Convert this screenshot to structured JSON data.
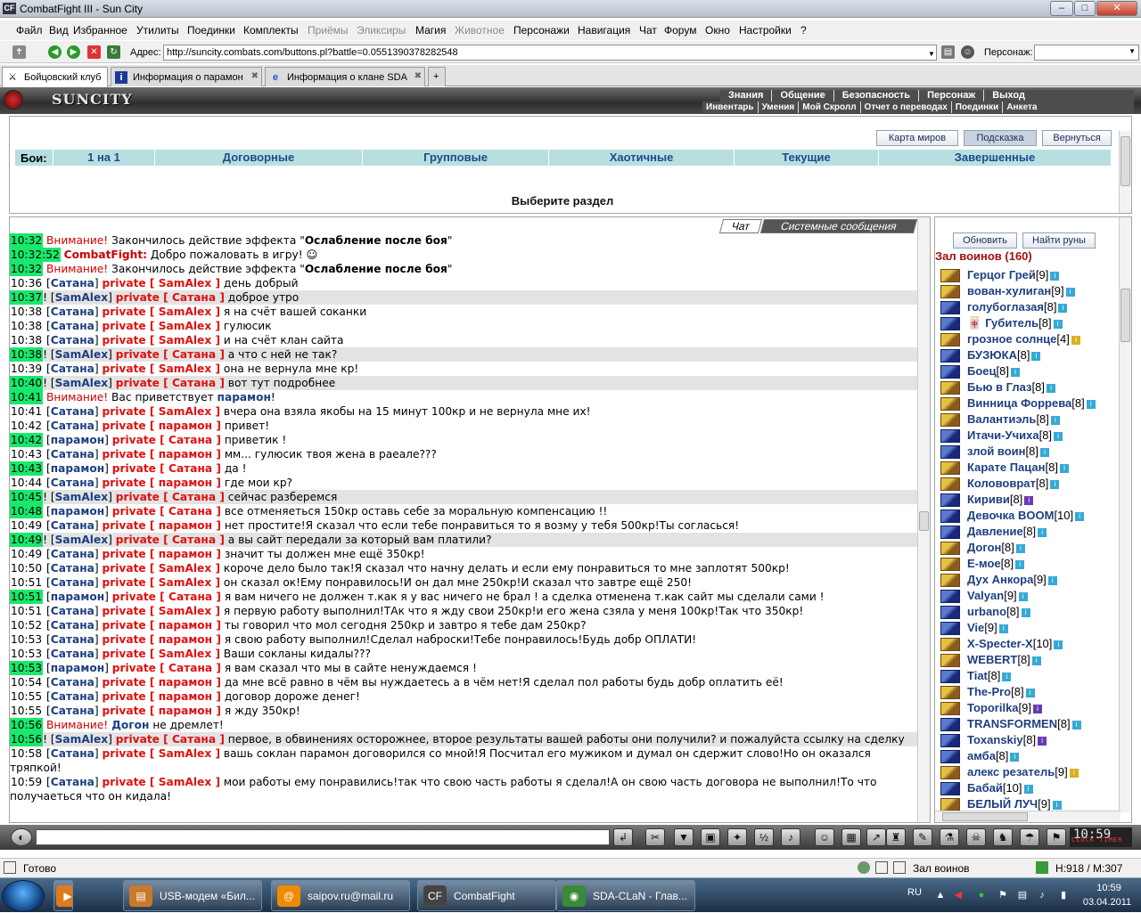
{
  "window": {
    "title": "CombatFight III - Sun City",
    "app_icon": "CF",
    "min": "–",
    "max": "□",
    "close": "✕"
  },
  "menu": [
    {
      "label": "Файл",
      "disabled": false
    },
    {
      "label": "Вид",
      "disabled": false
    },
    {
      "label": "Избранное",
      "disabled": false
    },
    {
      "label": "Утилиты",
      "disabled": false
    },
    {
      "label": "Поединки",
      "disabled": false
    },
    {
      "label": "Комплекты",
      "disabled": false
    },
    {
      "label": "Приёмы",
      "disabled": true
    },
    {
      "label": "Эликсиры",
      "disabled": true
    },
    {
      "label": "Магия",
      "disabled": false
    },
    {
      "label": "Животное",
      "disabled": true
    },
    {
      "label": "Персонажи",
      "disabled": false
    },
    {
      "label": "Навигация",
      "disabled": false
    },
    {
      "label": "Чат",
      "disabled": false
    },
    {
      "label": "Форум",
      "disabled": false
    },
    {
      "label": "Окно",
      "disabled": false
    },
    {
      "label": "Настройки",
      "disabled": false
    },
    {
      "label": "?",
      "disabled": false
    }
  ],
  "address": {
    "label": "Адрес:",
    "value": "http://suncity.combats.com/buttons.pl?battle=0.0551390378282548",
    "persona_label": "Персонаж:"
  },
  "tabs": [
    {
      "label": "Бойцовский клуб",
      "icon": "sword-icon",
      "glyph": "⚔"
    },
    {
      "label": "Информация о парамон",
      "icon": "info-icon",
      "glyph": "i"
    },
    {
      "label": "Информация о клане SDA",
      "icon": "browser-icon",
      "glyph": "e"
    }
  ],
  "header": {
    "logo": "SUNCITY",
    "nav1": [
      "Знания",
      "Общение",
      "Безопасность",
      "Персонаж",
      "Выход"
    ],
    "nav2": [
      "Инвентарь",
      "Умения",
      "Мой Скролл",
      "Отчет о переводах",
      "Поединки",
      "Анкета"
    ]
  },
  "upper": {
    "buttons": [
      "Карта миров",
      "Подсказка",
      "Вернуться"
    ],
    "battles_label": "Бои:",
    "battle_types": [
      "1 на 1",
      "Договорные",
      "Групповые",
      "Хаотичные",
      "Текущие",
      "Завершенные"
    ],
    "prompt": "Выберите раздел"
  },
  "chat": {
    "tab_chat": "Чат",
    "tab_system": "Системные сообщения",
    "messages": [
      {
        "t": "10:32",
        "g": true,
        "type": "sys",
        "pre": "Внимание!",
        "text": " Закончилось действие эффекта \"",
        "bold": "Ослабление после боя",
        "post": "\""
      },
      {
        "t": "10:32:52",
        "g": true,
        "type": "cf",
        "pre": "CombatFight:",
        "text": " Добро пожаловать в игру! ☺"
      },
      {
        "t": "10:32",
        "g": true,
        "type": "sys",
        "pre": "Внимание!",
        "text": " Закончилось действие эффекта \"",
        "bold": "Ослабление после боя",
        "post": "\""
      },
      {
        "t": "10:36",
        "from": "Сатана",
        "to": "SamAlex",
        "text": "день добрый"
      },
      {
        "t": "10:37",
        "g": true,
        "hl": true,
        "from": "SamAlex",
        "to": "Сатана",
        "text": "доброе утро",
        "excl": true
      },
      {
        "t": "10:38",
        "from": "Сатана",
        "to": "SamAlex",
        "text": "я на счёт вашей соканки"
      },
      {
        "t": "10:38",
        "from": "Сатана",
        "to": "SamAlex",
        "text": "гулюсик"
      },
      {
        "t": "10:38",
        "from": "Сатана",
        "to": "SamAlex",
        "text": "и на счёт клан сайта"
      },
      {
        "t": "10:38",
        "g": true,
        "hl": true,
        "from": "SamAlex",
        "to": "Сатана",
        "text": "а что с ней не так?",
        "excl": true
      },
      {
        "t": "10:39",
        "from": "Сатана",
        "to": "SamAlex",
        "text": "она не вернула мне кр!"
      },
      {
        "t": "10:40",
        "g": true,
        "hl": true,
        "from": "SamAlex",
        "to": "Сатана",
        "text": "вот тут подробнее",
        "excl": true
      },
      {
        "t": "10:41",
        "g": true,
        "type": "sys",
        "pre": "Внимание!",
        "text": " Вас приветствует ",
        "nick": "парамон",
        "post": "!"
      },
      {
        "t": "10:41",
        "from": "Сатана",
        "to": "SamAlex",
        "text": "вчера она взяла якобы на 15 минут 100кр и не вернула мне их!"
      },
      {
        "t": "10:42",
        "from": "Сатана",
        "to": "парамон",
        "text": "привет!"
      },
      {
        "t": "10:42",
        "g": true,
        "from": "парамон",
        "to": "Сатана",
        "text": "приветик !"
      },
      {
        "t": "10:43",
        "from": "Сатана",
        "to": "парамон",
        "text": "мм... гулюсик твоя жена в раеале???"
      },
      {
        "t": "10:43",
        "g": true,
        "from": "парамон",
        "to": "Сатана",
        "text": "да !"
      },
      {
        "t": "10:44",
        "from": "Сатана",
        "to": "парамон",
        "text": "где мои кр?"
      },
      {
        "t": "10:45",
        "g": true,
        "hl": true,
        "from": "SamAlex",
        "to": "Сатана",
        "text": "сейчас разберемся",
        "excl": true
      },
      {
        "t": "10:48",
        "g": true,
        "from": "парамон",
        "to": "Сатана",
        "text": "все отменяеться 150кр оставь себе за моральную компенсацию !!"
      },
      {
        "t": "10:49",
        "from": "Сатана",
        "to": "парамон",
        "text": "нет простите!Я сказал что если тебе понравиться то я возму у тебя 500кр!Ты согласься!"
      },
      {
        "t": "10:49",
        "g": true,
        "hl": true,
        "from": "SamAlex",
        "to": "Сатана",
        "text": "а вы сайт передали за который вам платили?",
        "excl": true
      },
      {
        "t": "10:49",
        "from": "Сатана",
        "to": "парамон",
        "text": "значит ты должен мне ещё 350кр!"
      },
      {
        "t": "10:50",
        "from": "Сатана",
        "to": "SamAlex",
        "text": "короче дело было так!Я сказал что начну делать и если ему понравиться то мне заплотят 500кр!"
      },
      {
        "t": "10:51",
        "from": "Сатана",
        "to": "SamAlex",
        "text": "он сказал ок!Ему понравилось!И он дал мне 250кр!И сказал что завтре ещё 250!"
      },
      {
        "t": "10:51",
        "g": true,
        "from": "парамон",
        "to": "Сатана",
        "text": "я вам ничего не должен т.как я у вас ничего не брал ! а сделка отменена т.как сайт мы сделали сами !"
      },
      {
        "t": "10:51",
        "from": "Сатана",
        "to": "SamAlex",
        "text": "я первую работу выполнил!ТАк что я жду свои 250кр!и его жена сзяла у меня 100кр!Так что 350кр!"
      },
      {
        "t": "10:52",
        "from": "Сатана",
        "to": "парамон",
        "text": "ты говорил что мол сегодня 250кр и завтро я тебе дам 250кр?"
      },
      {
        "t": "10:53",
        "from": "Сатана",
        "to": "парамон",
        "text": "я свою работу выполнил!Сделал наброски!Тебе понравилось!Будь добр ОПЛАТИ!"
      },
      {
        "t": "10:53",
        "from": "Сатана",
        "to": "SamAlex",
        "text": "Ваши сокланы кидалы???"
      },
      {
        "t": "10:53",
        "g": true,
        "from": "парамон",
        "to": "Сатана",
        "text": "я вам сказал что мы в сайте ненуждаемся !"
      },
      {
        "t": "10:54",
        "from": "Сатана",
        "to": "парамон",
        "text": "да мне всё равно в чём вы нуждаетесь а в чём нет!Я сделал пол работы будь добр оплатить её!"
      },
      {
        "t": "10:55",
        "from": "Сатана",
        "to": "парамон",
        "text": "договор дороже денег!"
      },
      {
        "t": "10:55",
        "from": "Сатана",
        "to": "парамон",
        "text": "я жду 350кр!"
      },
      {
        "t": "10:56",
        "g": true,
        "type": "sys",
        "pre": "Внимание!",
        "text": " ",
        "nick": "Догон",
        "post": " не дремлет!"
      },
      {
        "t": "10:56",
        "g": true,
        "hl": true,
        "from": "SamAlex",
        "to": "Сатана",
        "text": "первое, в обвинениях осторожнее, второе результаты вашей работы они получили? и пожалуйста ссылку на сделку",
        "excl": true
      },
      {
        "t": "10:58",
        "from": "Сатана",
        "to": "SamAlex",
        "text": "вашь соклан парамон договорился со мной!Я Посчитал его мужиком и думал он сдержит слово!Но он оказался тряпкой!"
      },
      {
        "t": "10:59",
        "from": "Сатана",
        "to": "SamAlex",
        "text": "мои работы ему понравились!так что свою часть работы я сделал!А он свою часть договора не выполнил!То что получаеться что он кидала!"
      }
    ]
  },
  "roster": {
    "refresh": "Обновить",
    "find_runes": "Найти руны",
    "title": "Зал воинов (160)",
    "players": [
      {
        "name": "Герцог Грей",
        "lvl": "[9]",
        "ic": "y",
        "inf": "b"
      },
      {
        "name": "вован-хулиган",
        "lvl": "[9]",
        "ic": "y",
        "inf": "b"
      },
      {
        "name": "голубоглазая",
        "lvl": "[8]",
        "ic": "b",
        "inf": "b"
      },
      {
        "name": "Губитель",
        "lvl": "[8]",
        "ic": "b",
        "inf": "b",
        "badge": "🀄"
      },
      {
        "name": "грозное солнце",
        "lvl": "[4]",
        "ic": "y",
        "inf": "g"
      },
      {
        "name": "БУЗЮКА",
        "lvl": "[8]",
        "ic": "b",
        "inf": "b"
      },
      {
        "name": "Боец",
        "lvl": "[8]",
        "ic": "b",
        "inf": "b"
      },
      {
        "name": "Бью в Глаз",
        "lvl": "[8]",
        "ic": "y",
        "inf": "b"
      },
      {
        "name": "Винница Форрева",
        "lvl": "[8]",
        "ic": "y",
        "inf": "b"
      },
      {
        "name": "Валантиэль",
        "lvl": "[8]",
        "ic": "y",
        "inf": "b"
      },
      {
        "name": "Итачи-Учиха",
        "lvl": "[8]",
        "ic": "b",
        "inf": "b"
      },
      {
        "name": "злой воин",
        "lvl": "[8]",
        "ic": "b",
        "inf": "b"
      },
      {
        "name": "Карате Пацан",
        "lvl": "[8]",
        "ic": "y",
        "inf": "b"
      },
      {
        "name": "Колововрат",
        "lvl": "[8]",
        "ic": "y",
        "inf": "b"
      },
      {
        "name": "Кириви",
        "lvl": "[8]",
        "ic": "b",
        "inf": "p"
      },
      {
        "name": "Девочка BOOM",
        "lvl": "[10]",
        "ic": "b",
        "inf": "b"
      },
      {
        "name": "Давление",
        "lvl": "[8]",
        "ic": "b",
        "inf": "b"
      },
      {
        "name": "Догон",
        "lvl": "[8]",
        "ic": "y",
        "inf": "b"
      },
      {
        "name": "Е-мое",
        "lvl": "[8]",
        "ic": "y",
        "inf": "b"
      },
      {
        "name": "Дух Анкора",
        "lvl": "[9]",
        "ic": "y",
        "inf": "b"
      },
      {
        "name": "Valyan",
        "lvl": "[9]",
        "ic": "b",
        "inf": "b"
      },
      {
        "name": "urbano",
        "lvl": "[8]",
        "ic": "b",
        "inf": "b"
      },
      {
        "name": "Vie",
        "lvl": "[9]",
        "ic": "b",
        "inf": "b"
      },
      {
        "name": "X-Specter-X",
        "lvl": "[10]",
        "ic": "y",
        "inf": "b"
      },
      {
        "name": "WEBERT",
        "lvl": "[8]",
        "ic": "y",
        "inf": "b"
      },
      {
        "name": "Tiat",
        "lvl": "[8]",
        "ic": "b",
        "inf": "b"
      },
      {
        "name": "The-Pro",
        "lvl": "[8]",
        "ic": "y",
        "inf": "b"
      },
      {
        "name": "Toporilka",
        "lvl": "[9]",
        "ic": "y",
        "inf": "p"
      },
      {
        "name": "TRANSFORMEN",
        "lvl": "[8]",
        "ic": "b",
        "inf": "b"
      },
      {
        "name": "Toxanskiy",
        "lvl": "[8]",
        "ic": "b",
        "inf": "p"
      },
      {
        "name": "амба",
        "lvl": "[8]",
        "ic": "b",
        "inf": "b"
      },
      {
        "name": "алекс резатель",
        "lvl": "[9]",
        "ic": "y",
        "inf": "g"
      },
      {
        "name": "Бабай",
        "lvl": "[10]",
        "ic": "b",
        "inf": "b"
      },
      {
        "name": "БЕЛЫЙ ЛУЧ",
        "lvl": "[9]",
        "ic": "y",
        "inf": "b"
      }
    ]
  },
  "toolbar": {
    "clock": "10:59",
    "clock_sub": "CLOCK TIMER",
    "icons": [
      "↲",
      "✂",
      "▼",
      "▣",
      "✦",
      "½",
      "♪",
      "☺",
      "▦",
      "↗",
      "♜",
      "✎",
      "⚗",
      "☠",
      "♞",
      "☂",
      "⚑",
      "⏏"
    ]
  },
  "statusbar": {
    "ready": "Готово",
    "location": "Зал воинов",
    "coords": "Н:918 / М:307"
  },
  "taskbar": {
    "items": [
      {
        "label": "USB-модем «Бил...",
        "glyph": "▤",
        "bg": "#c87a2a"
      },
      {
        "label": "saipov.ru@mail.ru",
        "glyph": "@",
        "bg": "#f08a00"
      },
      {
        "label": "CombatFight",
        "glyph": "CF",
        "bg": "#444"
      },
      {
        "label": "SDA-CLaN - Глав...",
        "glyph": "◉",
        "bg": "#3a8a3a"
      }
    ],
    "lang": "RU",
    "time": "10:59",
    "date": "03.04.2011"
  }
}
